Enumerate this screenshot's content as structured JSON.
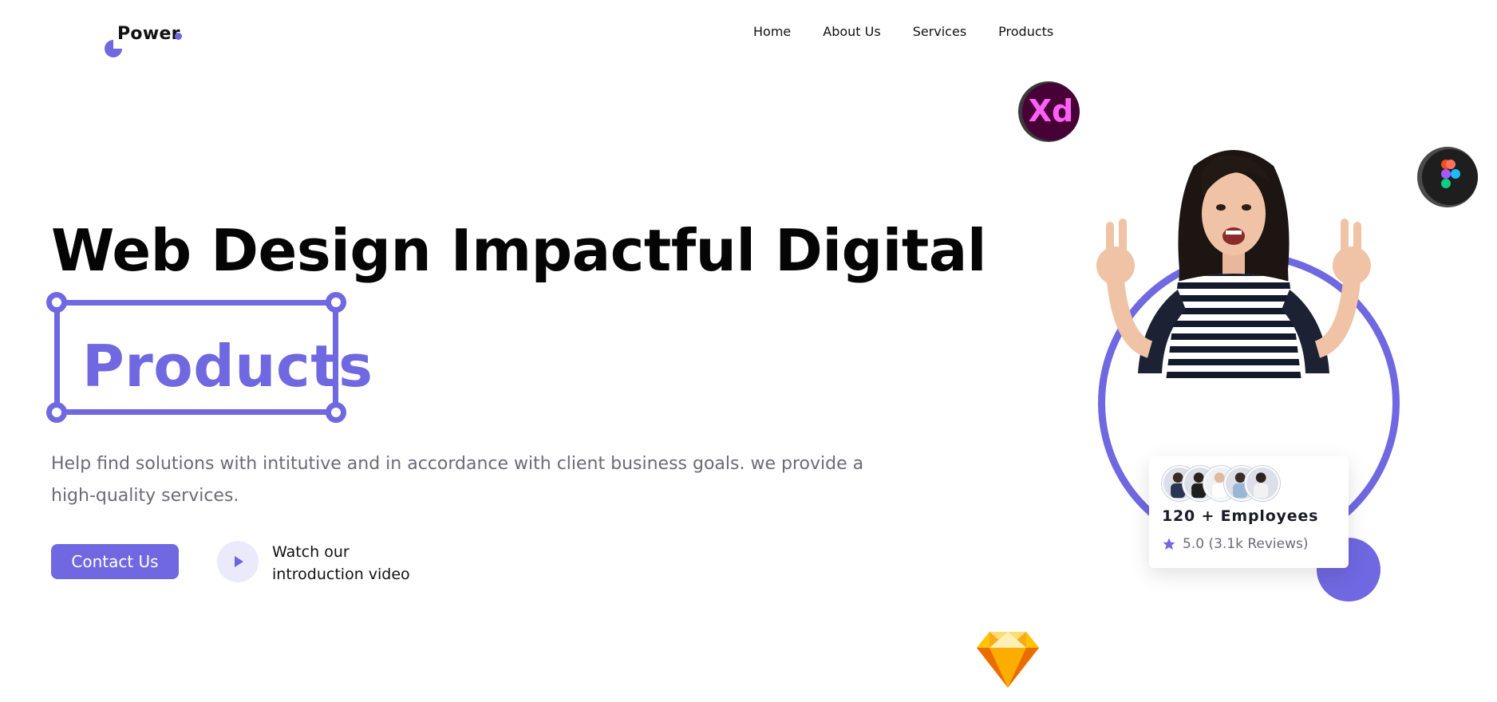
{
  "brand": {
    "name": "Power",
    "accent": "#7068e0"
  },
  "nav": {
    "items": [
      "Home",
      "About Us",
      "Services",
      "Products"
    ]
  },
  "hero": {
    "headline": "Web Design Impactful Digital",
    "highlight": "Products",
    "description": "Help find solutions with intitutive and in accordance with client business goals. we provide a high-quality services.",
    "contact_button": "Contact Us",
    "watch_line1": "Watch our",
    "watch_line2": "introduction video"
  },
  "employees_card": {
    "title": "120 + Employees",
    "rating": "5.0 (3.1k Reviews)"
  },
  "icons": [
    "adobe-xd-icon",
    "figma-icon",
    "sketch-icon",
    "play-icon",
    "star-icon"
  ],
  "colors": {
    "accent": "#7068e0",
    "text": "#111111",
    "muted": "#6b6b75",
    "play_bg": "#ebeafb"
  }
}
